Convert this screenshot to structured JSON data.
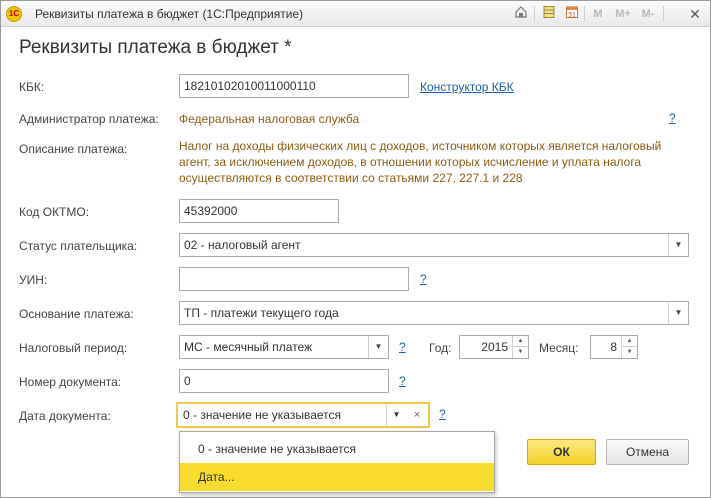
{
  "window": {
    "title": "Реквизиты платежа в бюджет (1С:Предприятие)",
    "logo_text": "1С",
    "toolbar": {
      "m": "M",
      "m_plus": "M+",
      "m_minus": "M-"
    }
  },
  "form": {
    "heading": "Реквизиты платежа в бюджет *",
    "kbk": {
      "label": "КБК:",
      "value": "18210102010011000110",
      "link": "Конструктор КБК"
    },
    "administrator": {
      "label": "Администратор платежа:",
      "value": "Федеральная налоговая служба",
      "help": "?"
    },
    "description": {
      "label": "Описание платежа:",
      "value": "Налог на доходы физических лиц с доходов, источником которых является налоговый агент, за исключением доходов, в отношении которых исчисление и уплата налога осуществляются в соответствии со статьями 227, 227.1 и 228"
    },
    "oktmo": {
      "label": "Код ОКТМО:",
      "value": "45392000"
    },
    "payer_status": {
      "label": "Статус плательщика:",
      "value": "02 - налоговый агент"
    },
    "uin": {
      "label": "УИН:",
      "value": "",
      "help": "?"
    },
    "payment_basis": {
      "label": "Основание платежа:",
      "value": "ТП - платежи текущего года"
    },
    "tax_period": {
      "label": "Налоговый период:",
      "value": "МС - месячный платеж",
      "help": "?",
      "year_label": "Год:",
      "year": "2015",
      "month_label": "Месяц:",
      "month": "8"
    },
    "doc_number": {
      "label": "Номер документа:",
      "value": "0",
      "help": "?"
    },
    "doc_date": {
      "label": "Дата документа:",
      "value": "0 - значение не указывается",
      "help": "?",
      "options": [
        "0 - значение не указывается",
        "Дата..."
      ],
      "highlighted": 1
    }
  },
  "buttons": {
    "ok": "ОК",
    "cancel": "Отмена"
  },
  "colors": {
    "accent": "#f3cf2a",
    "link": "#1d5ea9",
    "value_brown": "#8b5e12"
  }
}
